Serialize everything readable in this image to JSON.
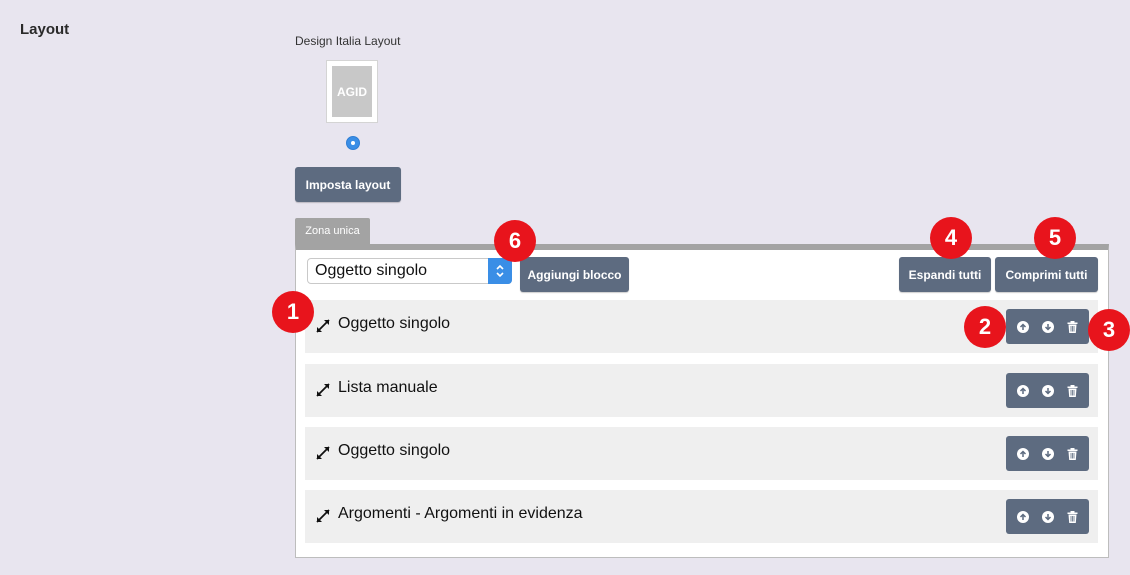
{
  "section": {
    "label": "Layout"
  },
  "layout_option": {
    "label": "Design Italia Layout",
    "thumbnail_text": "AGID",
    "selected": true
  },
  "buttons": {
    "set_layout": "Imposta layout",
    "add_block": "Aggiungi blocco",
    "expand_all": "Espandi tutti",
    "collapse_all": "Comprimi tutti"
  },
  "zone": {
    "tab_label": "Zona unica",
    "block_type_select": {
      "value": "Oggetto singolo"
    }
  },
  "blocks": [
    {
      "title": "Oggetto singolo"
    },
    {
      "title": "Lista manuale"
    },
    {
      "title": "Oggetto singolo"
    },
    {
      "title": "Argomenti - Argomenti in evidenza"
    }
  ],
  "icons": {
    "expand": "expand-arrows-icon",
    "move_up": "arrow-up-circle-icon",
    "move_down": "arrow-down-circle-icon",
    "delete": "trash-icon",
    "select_arrows": "chevron-up-down-icon"
  },
  "annotations": [
    "1",
    "2",
    "3",
    "4",
    "5",
    "6"
  ],
  "colors": {
    "background": "#e8e5ef",
    "button": "#5d6b80",
    "accent_blue": "#3a8ee6",
    "badge_red": "#e8141c",
    "tab_grey": "#a3a3a3",
    "block_bg": "#efefef"
  }
}
